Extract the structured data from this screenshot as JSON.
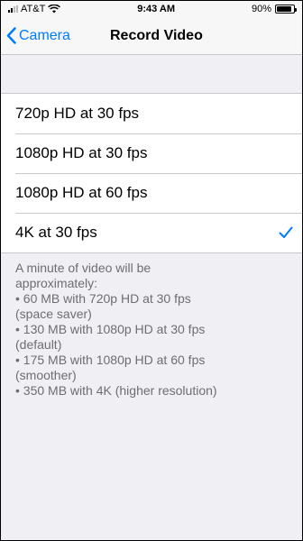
{
  "status": {
    "carrier": "AT&T",
    "time": "9:43 AM",
    "battery": "90%",
    "battery_level": 0.9
  },
  "nav": {
    "back_label": "Camera",
    "title": "Record Video"
  },
  "options": [
    {
      "label": "720p HD at 30 fps",
      "selected": false
    },
    {
      "label": "1080p HD at 30 fps",
      "selected": false
    },
    {
      "label": "1080p HD at 60 fps",
      "selected": false
    },
    {
      "label": "4K at 30 fps",
      "selected": true
    }
  ],
  "footer": {
    "lines": [
      "A minute of video will be",
      "approximately:",
      "• 60 MB with 720p HD at 30 fps",
      "(space saver)",
      "• 130 MB with 1080p HD at 30 fps",
      "(default)",
      "• 175 MB with 1080p HD at 60 fps",
      "(smoother)",
      "• 350 MB with 4K (higher resolution)"
    ]
  },
  "icons": {
    "back": "chevron-left-icon",
    "check": "checkmark-icon",
    "signal": "cellular-signal-icon",
    "wifi": "wifi-icon",
    "battery": "battery-icon"
  },
  "colors": {
    "accent": "#007aff",
    "background": "#efeff4",
    "footer_text": "#6d6d72"
  }
}
